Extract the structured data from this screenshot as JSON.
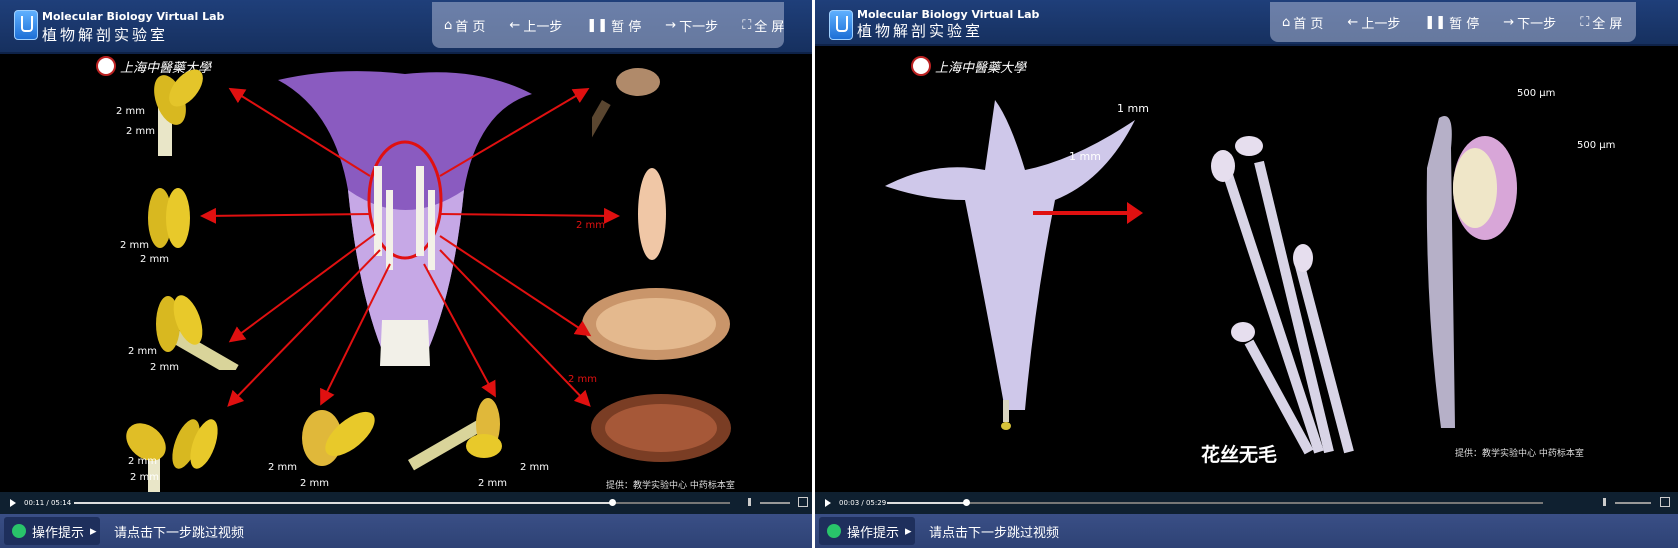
{
  "app": {
    "title_en": "Molecular Biology Virtual Lab",
    "title_cn": "植物解剖实验室"
  },
  "nav": {
    "home": "首 页",
    "prev": "上一步",
    "pause": "暂 停",
    "next": "下一步",
    "fullscreen": "全 屏"
  },
  "panel1": {
    "university": "上海中醫藥大學",
    "scales": {
      "a": "2 mm",
      "b": "2 mm",
      "c": "2 mm",
      "d": "2 mm",
      "e": "2 mm",
      "f": "2 mm",
      "g": "2 mm",
      "h": "2 mm",
      "i": "2 mm",
      "j": "2 mm",
      "k": "2 mm",
      "l": "2 mm",
      "m": "2 mm",
      "n": "2 mm"
    },
    "credit": "提供：教学实验中心 中药标本室",
    "player": {
      "time": "00:11 / 05:14",
      "progress": 0.82,
      "volume": 0.9
    },
    "hint_label": "操作提示",
    "hint_text": "请点击下一步跳过视频"
  },
  "panel2": {
    "university": "上海中醫藥大學",
    "scales": {
      "top": "1 mm",
      "side": "1 mm",
      "right_top": "500 μm",
      "right_side": "500 μm"
    },
    "caption": "花丝无毛",
    "credit": "提供：教学实验中心 中药标本室",
    "player": {
      "time": "00:03 / 05:29",
      "progress": 0.12,
      "volume": 0.9
    },
    "hint_label": "操作提示",
    "hint_text": "请点击下一步跳过视频"
  },
  "colors": {
    "header": "#1f3f7a",
    "bottombar": "#3a4f86",
    "arrow": "#e01010",
    "corolla": "#8a5bc0",
    "anther": "#e3c12a"
  },
  "icons": [
    "logo-icon",
    "home-icon",
    "arrow-left-icon",
    "pause-icon",
    "arrow-right-icon",
    "fullscreen-icon",
    "play-icon",
    "volume-icon",
    "expand-icon",
    "hint-icon",
    "caret-right-icon",
    "university-seal-icon"
  ]
}
